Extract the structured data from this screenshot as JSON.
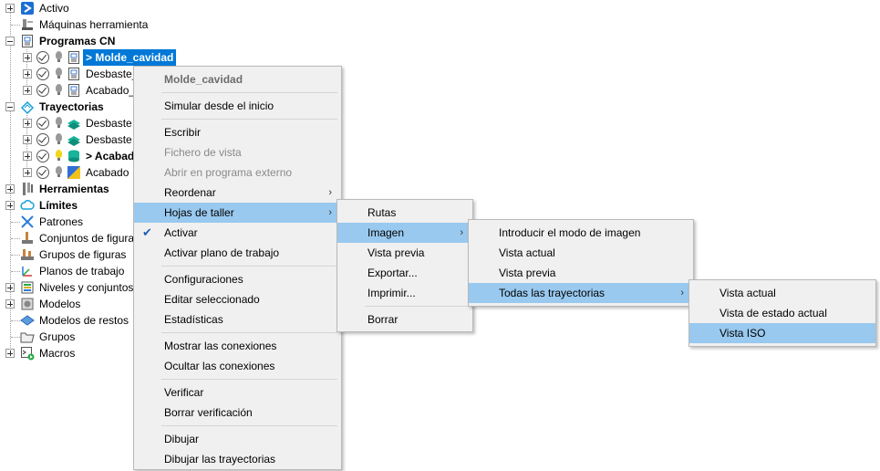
{
  "tree": {
    "items": [
      {
        "label": "Activo",
        "bold": false
      },
      {
        "label": "Máquinas herramienta",
        "bold": false
      },
      {
        "label": "Programas CN",
        "bold": true
      },
      {
        "label": "> Molde_cavidad",
        "bold": true
      },
      {
        "label": "Desbaste_",
        "bold": false
      },
      {
        "label": "Acabado_",
        "bold": false
      },
      {
        "label": "Trayectorias",
        "bold": true
      },
      {
        "label": "Desbaste",
        "bold": false
      },
      {
        "label": "Desbaste",
        "bold": false
      },
      {
        "label": "> Acabad",
        "bold": true
      },
      {
        "label": "Acabado",
        "bold": false
      },
      {
        "label": "Herramientas",
        "bold": true
      },
      {
        "label": "Límites",
        "bold": true
      },
      {
        "label": "Patrones",
        "bold": false
      },
      {
        "label": "Conjuntos de figura",
        "bold": false
      },
      {
        "label": "Grupos de figuras",
        "bold": false
      },
      {
        "label": "Planos de trabajo",
        "bold": false
      },
      {
        "label": "Niveles y conjuntos",
        "bold": false
      },
      {
        "label": "Modelos",
        "bold": false
      },
      {
        "label": "Modelos de restos",
        "bold": false
      },
      {
        "label": "Grupos",
        "bold": false
      },
      {
        "label": "Macros",
        "bold": false
      }
    ]
  },
  "context_menu": {
    "header": "Molde_cavidad",
    "items": [
      {
        "label": "Simular desde el inicio"
      },
      {
        "label": "Escribir"
      },
      {
        "label": "Fichero de vista",
        "disabled": true
      },
      {
        "label": "Abrir en programa externo",
        "disabled": true
      },
      {
        "label": "Reordenar"
      },
      {
        "label": "Hojas de taller"
      },
      {
        "label": "Activar"
      },
      {
        "label": "Activar plano de trabajo"
      },
      {
        "label": "Configuraciones"
      },
      {
        "label": "Editar seleccionado"
      },
      {
        "label": "Estadísticas"
      },
      {
        "label": "Mostrar las conexiones"
      },
      {
        "label": "Ocultar las conexiones"
      },
      {
        "label": "Verificar"
      },
      {
        "label": "Borrar verificación"
      },
      {
        "label": "Dibujar"
      },
      {
        "label": "Dibujar las trayectorias"
      }
    ]
  },
  "submenu_hojas": {
    "items": [
      {
        "label": "Rutas"
      },
      {
        "label": "Imagen"
      },
      {
        "label": "Vista previa"
      },
      {
        "label": "Exportar..."
      },
      {
        "label": "Imprimir..."
      },
      {
        "label": "Borrar"
      }
    ]
  },
  "submenu_imagen": {
    "items": [
      {
        "label": "Introducir el modo de imagen"
      },
      {
        "label": "Vista actual"
      },
      {
        "label": "Vista previa"
      },
      {
        "label": "Todas las trayectorias"
      }
    ]
  },
  "submenu_todas": {
    "items": [
      {
        "label": "Vista actual"
      },
      {
        "label": "Vista de estado actual"
      },
      {
        "label": "Vista ISO"
      }
    ]
  },
  "colors": {
    "selection": "#0078d7",
    "menu_highlight": "#99c9ef",
    "menu_bg": "#f0f0f0"
  }
}
